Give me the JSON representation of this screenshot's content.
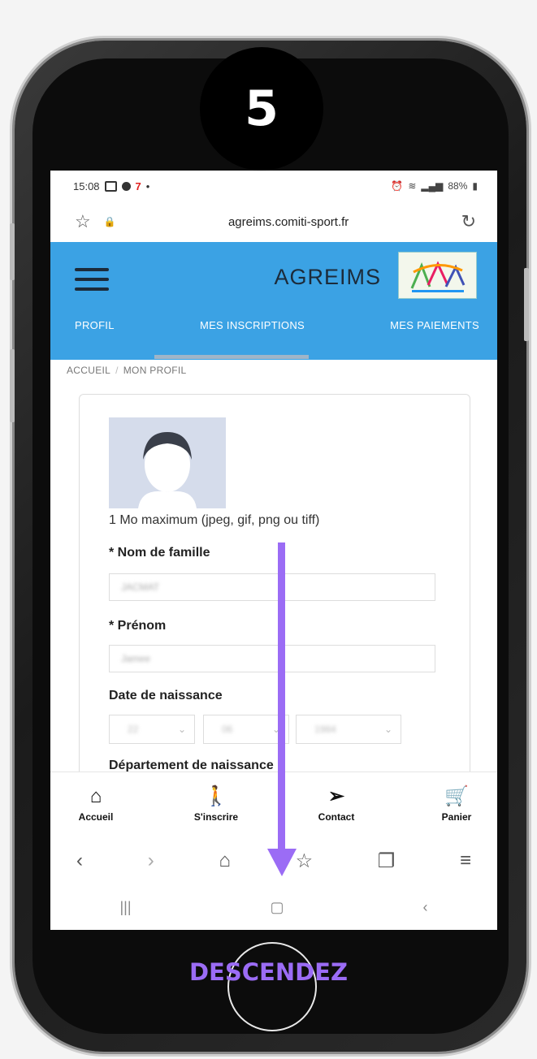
{
  "step": {
    "number": "5"
  },
  "caption": "DESCENDEZ",
  "status_bar": {
    "time": "15:08",
    "battery": "88%"
  },
  "browser": {
    "url": "agreims.comiti-sport.fr"
  },
  "header": {
    "brand": "AGREIMS",
    "tabs": [
      "PROFIL",
      "MES INSCRIPTIONS",
      "MES PAIEMENTS"
    ]
  },
  "breadcrumb": {
    "home": "ACCUEIL",
    "separator": "/",
    "current": "MON PROFIL"
  },
  "form": {
    "avatar_hint": "1 Mo maximum (jpeg, gif, png ou tiff)",
    "last_name_label": "* Nom de famille",
    "last_name_value": "JACMAT",
    "first_name_label": "* Prénom",
    "first_name_value": "Jamee",
    "birth_date_label": "Date de naissance",
    "birth_day": "22",
    "birth_month": "06",
    "birth_year": "1984",
    "birth_department_label": "Département de naissance"
  },
  "bottom_nav": {
    "home": "Accueil",
    "register": "S'inscrire",
    "contact": "Contact",
    "cart": "Panier"
  },
  "colors": {
    "accent": "#9b6cf5",
    "header": "#3ba2e4"
  }
}
